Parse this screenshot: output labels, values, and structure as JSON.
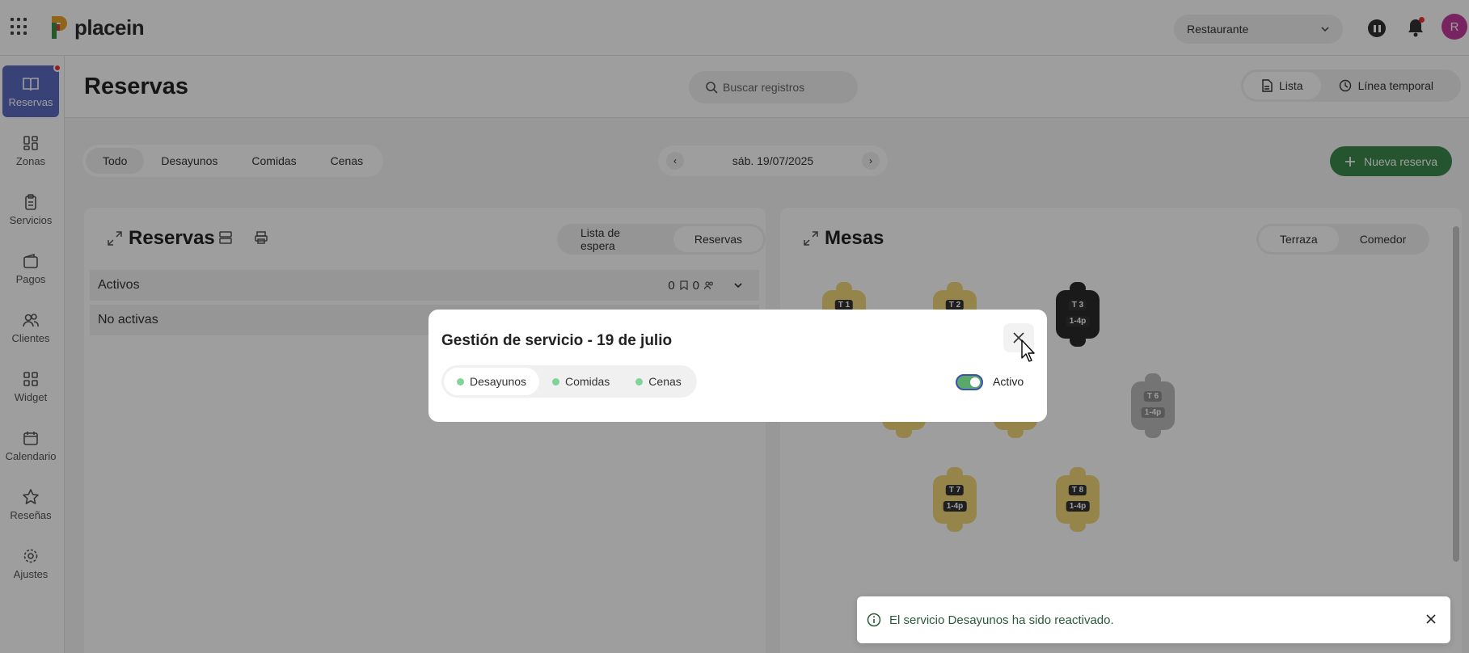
{
  "app": {
    "logo_text": "placein",
    "brand_color": "#5c6bc0"
  },
  "header": {
    "venue_select": "Restaurante",
    "avatar_initial": "R"
  },
  "sidebar": {
    "items": [
      {
        "label": "Reservas",
        "icon": "book-open-icon",
        "active": true
      },
      {
        "label": "Zonas",
        "icon": "layout-icon"
      },
      {
        "label": "Servicios",
        "icon": "clipboard-icon"
      },
      {
        "label": "Pagos",
        "icon": "wallet-icon"
      },
      {
        "label": "Clientes",
        "icon": "users-icon"
      },
      {
        "label": "Widget",
        "icon": "grid-icon"
      },
      {
        "label": "Calendario",
        "icon": "calendar-icon"
      },
      {
        "label": "Reseñas",
        "icon": "star-icon"
      },
      {
        "label": "Ajustes",
        "icon": "gear-icon"
      }
    ]
  },
  "main": {
    "title": "Reservas",
    "search_placeholder": "Buscar registros",
    "view_toggle": {
      "list": "Lista",
      "timeline": "Línea temporal"
    },
    "filters": [
      "Todo",
      "Desayunos",
      "Comidas",
      "Cenas"
    ],
    "date": "sáb. 19/07/2025",
    "new_reservation": "Nueva reserva"
  },
  "reservations_panel": {
    "title": "Reservas",
    "tabs": [
      "Lista de espera",
      "Reservas"
    ],
    "groups": [
      {
        "label": "Activos",
        "bookmarks": "0",
        "people": "0"
      },
      {
        "label": "No activas"
      }
    ]
  },
  "tables_panel": {
    "title": "Mesas",
    "zones": [
      "Terraza",
      "Comedor"
    ],
    "tables": [
      {
        "name": "T 1",
        "status": "yellow"
      },
      {
        "name": "T 2",
        "status": "yellow"
      },
      {
        "name": "T 3",
        "cap": "1-4p",
        "status": "dark"
      },
      {
        "name": "T 6",
        "cap": "1-4p",
        "status": "grey"
      },
      {
        "name": "T 7",
        "cap": "1-4p",
        "status": "yellow"
      },
      {
        "name": "T 8",
        "cap": "1-4p",
        "status": "yellow"
      }
    ]
  },
  "modal": {
    "title": "Gestión de servicio - 19 de julio",
    "services": [
      "Desayunos",
      "Comidas",
      "Cenas"
    ],
    "toggle_label": "Activo",
    "toggle_on": true
  },
  "toast": {
    "message": "El servicio Desayunos ha sido reactivado."
  }
}
